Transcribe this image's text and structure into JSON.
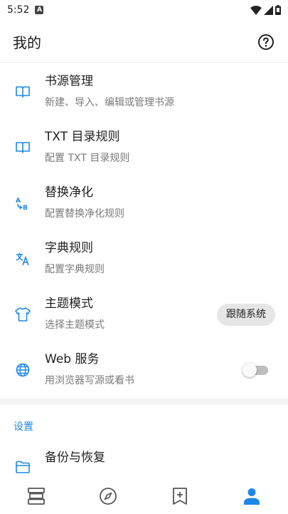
{
  "status_bar": {
    "time": "5:52",
    "notification_badge": "A"
  },
  "app_bar": {
    "title": "我的",
    "help_icon": "help-circle-icon"
  },
  "items": [
    {
      "title": "书源管理",
      "subtitle": "新建、导入、编辑或管理书源",
      "icon": "book-open-icon"
    },
    {
      "title": "TXT 目录规则",
      "subtitle": "配置 TXT 目录规则",
      "icon": "book-open-icon"
    },
    {
      "title": "替换净化",
      "subtitle": "配置替换净化规则",
      "icon": "replace-ab-icon"
    },
    {
      "title": "字典规则",
      "subtitle": "配置字典规则",
      "icon": "translate-icon"
    },
    {
      "title": "主题模式",
      "subtitle": "选择主题模式",
      "icon": "tshirt-icon",
      "chip": "跟随系统"
    },
    {
      "title": "Web 服务",
      "subtitle": "用浏览器写源或看书",
      "icon": "globe-icon",
      "toggle_on": false
    }
  ],
  "section": {
    "title": "设置"
  },
  "backup": {
    "title": "备份与恢复",
    "icon": "folder-icon"
  },
  "bottom_nav": [
    {
      "name": "bookshelf",
      "icon": "bookshelf-icon",
      "active": false
    },
    {
      "name": "discover",
      "icon": "compass-icon",
      "active": false
    },
    {
      "name": "rss",
      "icon": "bookmark-plus-icon",
      "active": false
    },
    {
      "name": "my",
      "icon": "person-icon",
      "active": true
    }
  ],
  "colors": {
    "accent": "#1e88e5",
    "icon_gray": "#555555",
    "subtitle": "#7a7a7a"
  }
}
